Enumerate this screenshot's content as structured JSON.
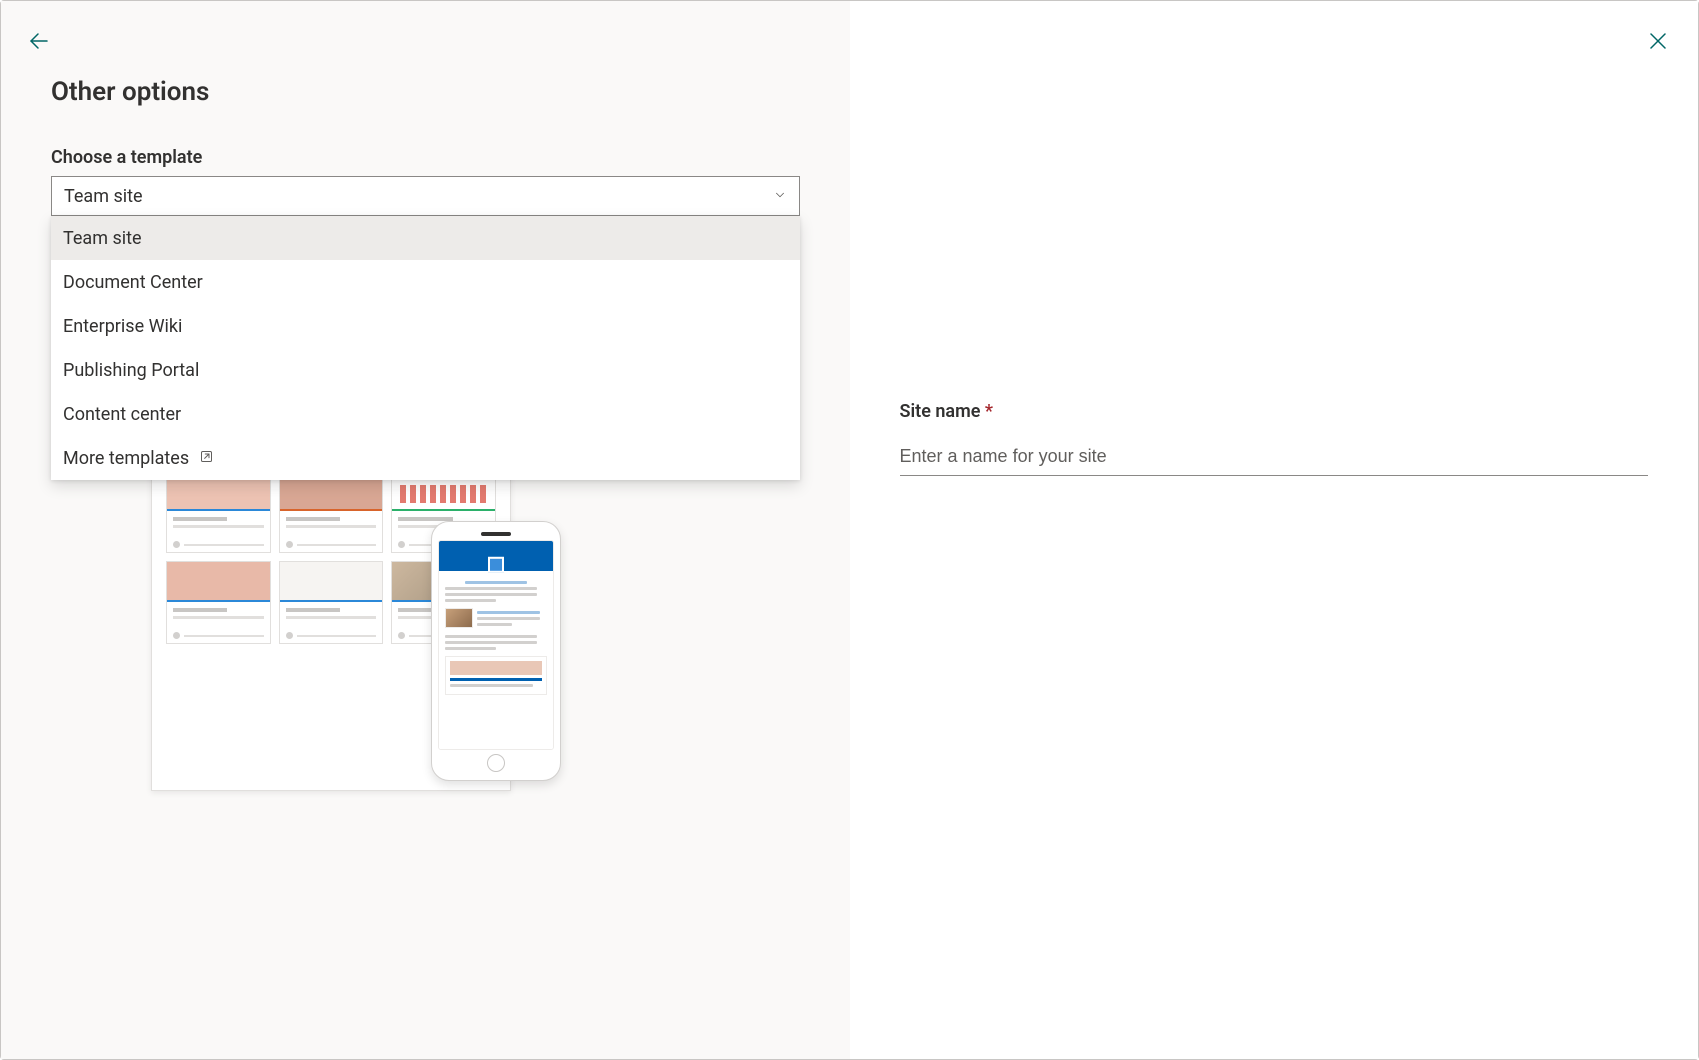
{
  "header": {
    "title": "Other options"
  },
  "template_picker": {
    "label": "Choose a template",
    "selected": "Team site",
    "options": {
      "team_site": "Team site",
      "document_center": "Document Center",
      "enterprise_wiki": "Enterprise Wiki",
      "publishing_portal": "Publishing Portal",
      "content_center": "Content center",
      "more_templates": "More templates"
    }
  },
  "form": {
    "site_name_label": "Site name",
    "site_name_required": "*",
    "site_name_placeholder": "Enter a name for your site"
  }
}
